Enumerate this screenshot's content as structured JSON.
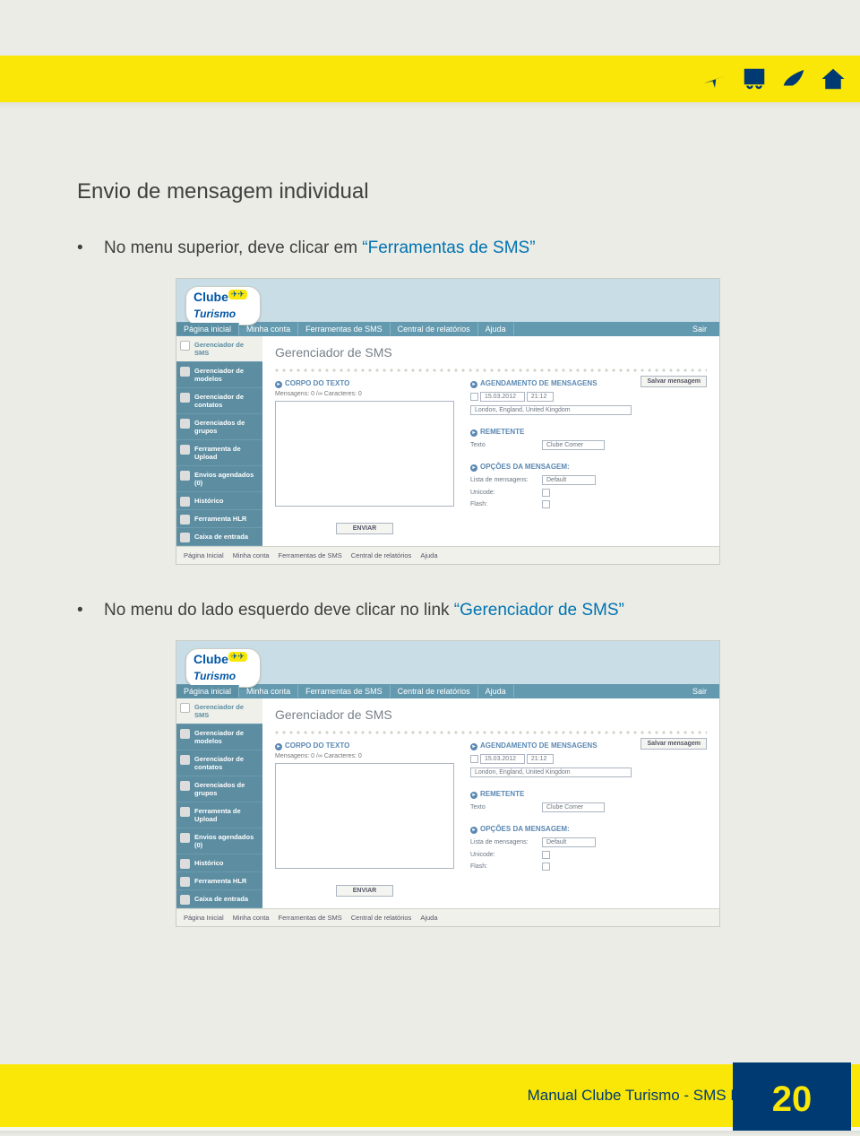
{
  "page": {
    "section_title": "Envio de mensagem individual",
    "bullets": [
      {
        "prefix": "No menu superior, deve clicar em ",
        "link": "“Ferramentas de SMS”"
      },
      {
        "prefix": "No menu do lado esquerdo deve clicar no link ",
        "link": "“Gerenciador de SMS”"
      }
    ],
    "footer_label": "Manual Clube Turismo - SMS Marketing",
    "page_number": "20"
  },
  "app": {
    "logo": {
      "line1": "Clube",
      "line2": "Turismo",
      "badge": "✈✈"
    },
    "nav": {
      "items": [
        "Página inicial",
        "Minha conta",
        "Ferramentas de SMS",
        "Central de relatórios",
        "Ajuda"
      ],
      "exit": "Sair"
    },
    "sidebar": [
      "Gerenciador de SMS",
      "Gerenciador de modelos",
      "Gerenciador de contatos",
      "Gerenciados de grupos",
      "Ferramenta de Upload",
      "Envios agendados (0)",
      "Histórico",
      "Ferramenta HLR",
      "Caixa de entrada"
    ],
    "panel": {
      "title": "Gerenciador de SMS",
      "corpo_label": "CORPO DO TEXTO",
      "info_line": "Mensagens: 0    /∞  Caracteres: 0",
      "save_btn": "Salvar mensagem",
      "send_btn": "ENVIAR",
      "agendamento": {
        "label": "AGENDAMENTO DE MENSAGENS",
        "date": "15.03.2012",
        "time": "21:12",
        "tz": "London, England, United Kingdom"
      },
      "remetente": {
        "label": "REMETENTE",
        "field_label": "Texto",
        "value": "Clube Comer"
      },
      "opcoes": {
        "label": "OPÇÕES DA MENSAGEM:",
        "lista_label": "Lista de mensagens:",
        "lista_value": "Default",
        "unicode_label": "Unicode:",
        "flash_label": "Flash:"
      }
    },
    "footer_nav": [
      "Página Inicial",
      "Minha conta",
      "Ferramentas de SMS",
      "Central de relatórios",
      "Ajuda"
    ]
  }
}
